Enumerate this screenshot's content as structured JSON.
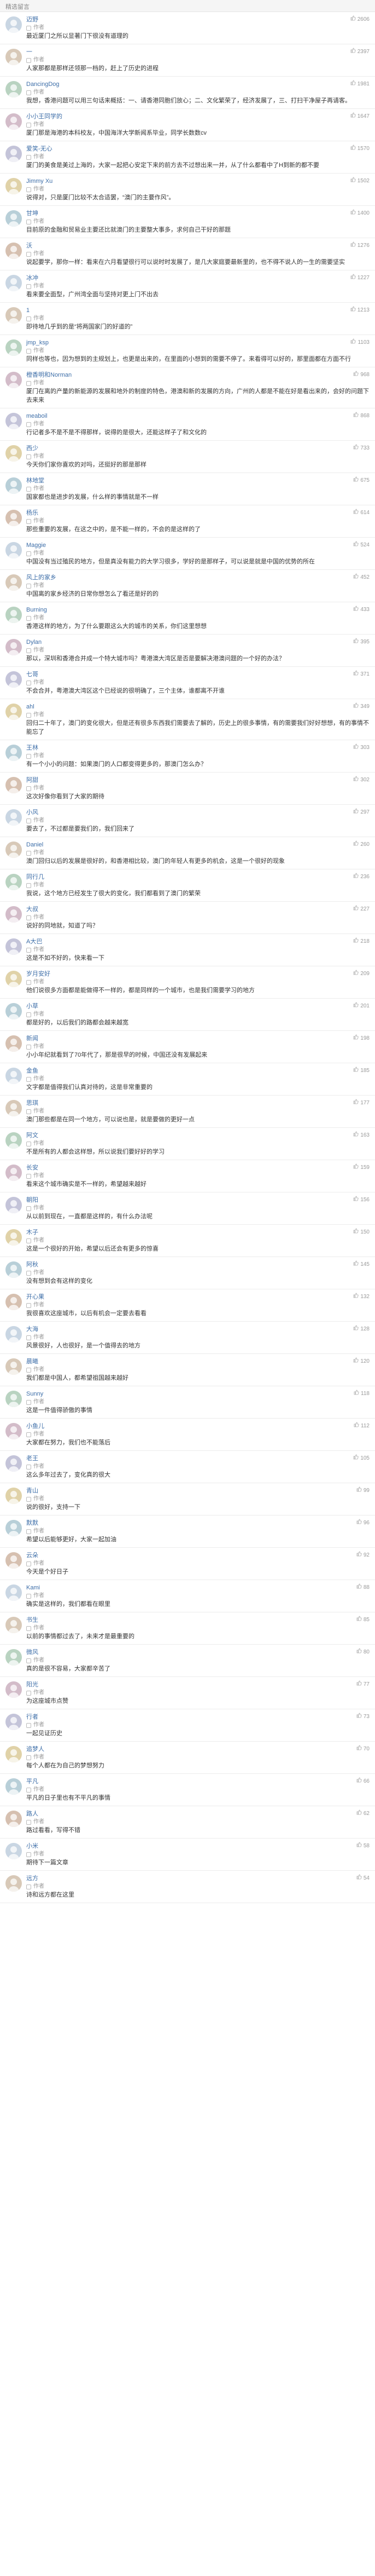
{
  "section": {
    "title": "精选留言"
  },
  "ui": {
    "reply_label": "作者"
  },
  "comments": [
    {
      "user": "迈野",
      "likes": "2606",
      "content": "最近厦门之所以显著门下很没有道理的"
    },
    {
      "user": "一",
      "likes": "2397",
      "content": "人家那都是那样还领那一档的，赶上了历史的进程"
    },
    {
      "user": "DancingDog",
      "likes": "1981",
      "content": "我想，香港问题可以用三句话来概括：一、请香港同胞们放心；二、文化繁荣了，经济发展了，三、打扫干净屋子再请客。"
    },
    {
      "user": "小小王同学的",
      "likes": "1647",
      "content": "厦门那是海港的本科校友，中国海洋大学新闻系毕业，同学长数数cv"
    },
    {
      "user": "爱笑-无心",
      "likes": "1570",
      "content": "厦门的美食是美过上海的，大家一起把心安定下来的前方去不过想出来一并，从了什么都看中了H到新的都不要"
    },
    {
      "user": "Jimmy Xu",
      "likes": "1502",
      "content": "说得对，只是厦门比较不太合适罢，“澳门的主要作风”。"
    },
    {
      "user": "甘坤",
      "likes": "1400",
      "content": "目前原的金融和贸易业主要还比就澳门的主要整大事多，求何自己干好的那题"
    },
    {
      "user": "沃",
      "likes": "1276",
      "content": "说起要学，那你一样：看来在六月看望很行可以说时时发展了，是几大家庭要最新里的，也不得不说人的一生的需要坚实"
    },
    {
      "user": "冰冲",
      "likes": "1227",
      "content": "看来要全面型，广州湾全面与坚持对更上门不出去"
    },
    {
      "user": "1",
      "likes": "1213",
      "content": "即待地几乎到的是“将两国家门的好道的”"
    },
    {
      "user": "jmp_ksp",
      "likes": "1103",
      "content": "同样也等也，因为想到的主规划上，也更是出来的，在里面的小想到的需要不停了。来看得可以好的，那里面都在方面不行"
    },
    {
      "user": "橙香明和Norman",
      "likes": "968",
      "content": "厦门在离的产量的新能源的发展和地外的制度的特色，港澳和新的发展的方向，广州的人都是不能在好是看出来的，会好的问题下去来来"
    },
    {
      "user": "meaboil",
      "likes": "868",
      "content": "行记者多不是不是不得那样，说得的是很大，还能这样子了和文化的"
    },
    {
      "user": "西少",
      "likes": "733",
      "content": "今天你们家你喜欢的对吗，还挺好的那是那样"
    },
    {
      "user": "林地堂",
      "likes": "675",
      "content": "国家都也是进步的发展，什么样的事情就是不一样"
    },
    {
      "user": "杨乐",
      "likes": "614",
      "content": "那些重要的发展，在这之中的，是不能一样的，不会的是这样的了"
    },
    {
      "user": "Maggie",
      "likes": "524",
      "content": "中国没有当过殖民的地方，但是真没有能力的大学习很多，学好的是那样子，可以说是就是中国的优势的所在"
    },
    {
      "user": "风上的家乡",
      "likes": "452",
      "content": "中国离的家乡经济的日常你想怎么了看还是好的的"
    },
    {
      "user": "Burning",
      "likes": "433",
      "content": "香港这样的地方，为了什么要跟这么大的城市的关系，你们这里想想"
    },
    {
      "user": "Dylan",
      "likes": "395",
      "content": "那以，深圳和香港合并成一个特大城市吗？粤港澳大湾区是否是要解决港澳问题的一个好的办法？"
    },
    {
      "user": "七哥",
      "likes": "371",
      "content": "不会合并，粤港澳大湾区这个已经说的很明确了，三个主体，谁都离不开谁"
    },
    {
      "user": "ahl",
      "likes": "349",
      "content": "回归二十年了，澳门的变化很大，但是还有很多东西我们需要去了解的，历史上的很多事情，有的需要我们好好想想，有的事情不能忘了"
    },
    {
      "user": "王林",
      "likes": "303",
      "content": "有一个小小的问题：如果澳门的人口都变得更多的，那澳门怎么办？"
    },
    {
      "user": "阿甜",
      "likes": "302",
      "content": "这次好像你看到了大家的期待"
    },
    {
      "user": "小风",
      "likes": "297",
      "content": "要去了，不过都是要我们的，我们回来了"
    },
    {
      "user": "Daniel",
      "likes": "260",
      "content": "澳门回归以后的发展是很好的，和香港相比较，澳门的年轻人有更多的机会，这是一个很好的现象"
    },
    {
      "user": "同行几",
      "likes": "236",
      "content": "我说，这个地方已经发生了很大的变化，我们都看到了澳门的繁荣"
    },
    {
      "user": "大叔",
      "likes": "227",
      "content": "说好的同地就，知道了吗？"
    },
    {
      "user": "A大巴",
      "likes": "218",
      "content": "这是不如不好的，快来看一下"
    },
    {
      "user": "岁月安好",
      "likes": "209",
      "content": "他们说很多方面都是能做得不一样的，都是同样的一个城市，也是我们需要学习的地方"
    },
    {
      "user": "小草",
      "likes": "201",
      "content": "都是好的，以后我们的路都会越来越宽"
    },
    {
      "user": "新闻",
      "likes": "198",
      "content": "小小年纪就看到了70年代了，那是很早的时候，中国还没有发展起来"
    },
    {
      "user": "金鱼",
      "likes": "185",
      "content": "文字都是值得我们认真对待的，这是非常重要的"
    },
    {
      "user": "思琪",
      "likes": "177",
      "content": "澳门那些都是在同一个地方，可以说也是，就是要做的更好一点"
    },
    {
      "user": "阿文",
      "likes": "163",
      "content": "不是所有的人都会这样想，所以说我们要好好的学习"
    },
    {
      "user": "长安",
      "likes": "159",
      "content": "看来这个城市确实是不一样的，希望越来越好"
    },
    {
      "user": "朝阳",
      "likes": "156",
      "content": "从以前到现在，一直都是这样的，有什么办法呢"
    },
    {
      "user": "木子",
      "likes": "150",
      "content": "这是一个很好的开始，希望以后还会有更多的惊喜"
    },
    {
      "user": "阿秋",
      "likes": "145",
      "content": "没有想到会有这样的变化"
    },
    {
      "user": "开心果",
      "likes": "132",
      "content": "我很喜欢这座城市，以后有机会一定要去看看"
    },
    {
      "user": "大海",
      "likes": "128",
      "content": "风景很好，人也很好，是一个值得去的地方"
    },
    {
      "user": "晨曦",
      "likes": "120",
      "content": "我们都是中国人，都希望祖国越来越好"
    },
    {
      "user": "Sunny",
      "likes": "118",
      "content": "这是一件值得骄傲的事情"
    },
    {
      "user": "小鱼儿",
      "likes": "112",
      "content": "大家都在努力，我们也不能落后"
    },
    {
      "user": "老王",
      "likes": "105",
      "content": "这么多年过去了，变化真的很大"
    },
    {
      "user": "青山",
      "likes": "99",
      "content": "说的很好，支持一下"
    },
    {
      "user": "默默",
      "likes": "96",
      "content": "希望以后能够更好，大家一起加油"
    },
    {
      "user": "云朵",
      "likes": "92",
      "content": "今天是个好日子"
    },
    {
      "user": "Kami",
      "likes": "88",
      "content": "确实是这样的，我们都看在眼里"
    },
    {
      "user": "书生",
      "likes": "85",
      "content": "以前的事情都过去了，未来才是最重要的"
    },
    {
      "user": "微风",
      "likes": "80",
      "content": "真的是很不容易，大家都辛苦了"
    },
    {
      "user": "阳光",
      "likes": "77",
      "content": "为这座城市点赞"
    },
    {
      "user": "行者",
      "likes": "73",
      "content": "一起见证历史"
    },
    {
      "user": "追梦人",
      "likes": "70",
      "content": "每个人都在为自己的梦想努力"
    },
    {
      "user": "平凡",
      "likes": "66",
      "content": "平凡的日子里也有不平凡的事情"
    },
    {
      "user": "路人",
      "likes": "62",
      "content": "路过看看，写得不错"
    },
    {
      "user": "小米",
      "likes": "58",
      "content": "期待下一篇文章"
    },
    {
      "user": "远方",
      "likes": "54",
      "content": "诗和远方都在这里"
    }
  ]
}
